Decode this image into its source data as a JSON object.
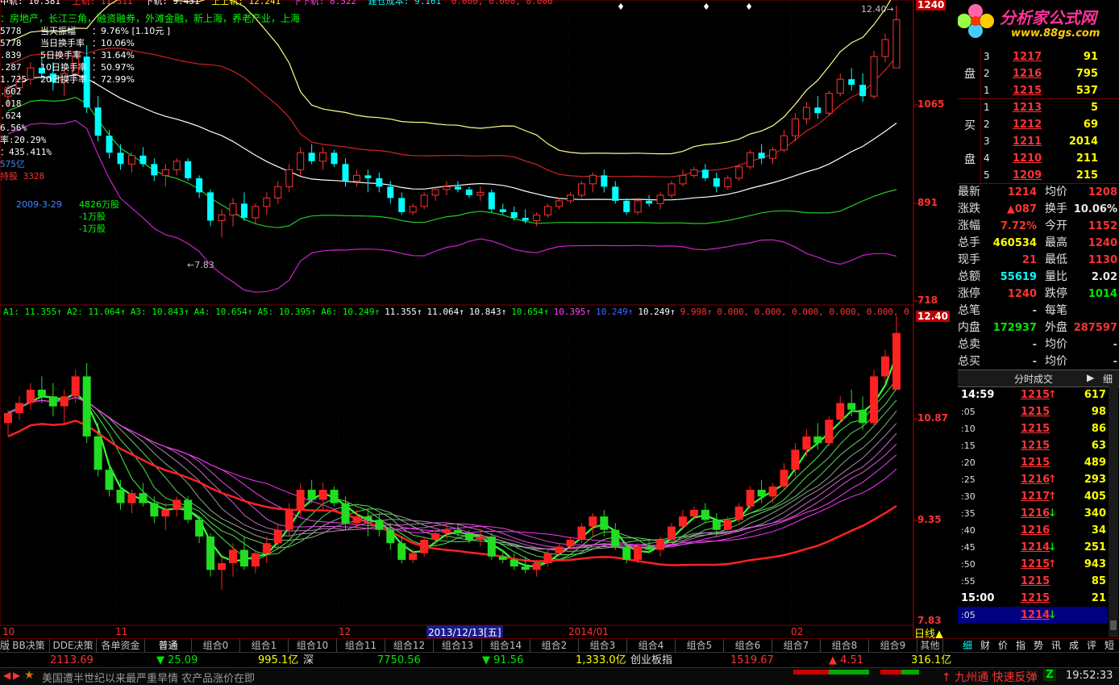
{
  "chart_top": {
    "stock_tags": "：房地产，长江三角，融资融券，外滩金融，新上海，养老产业，上海",
    "header_items": [
      "中轨: 10.381",
      "上轨: 11.311",
      "下轨: 9.451",
      "上上轨: 12.241",
      "下下轨: 8.522",
      "建仓成本: 9.161"
    ],
    "header_tail": "0.000, 0.000, 0.000",
    "left_cut": [
      "5778",
      "5778",
      ".839",
      ".287",
      "1.725",
      ".602",
      ".018",
      ".624",
      "6.56%",
      "率:20.29%",
      "：435.411%",
      "575亿",
      "持股 3328"
    ],
    "info_box": [
      {
        "label": "当天振幅",
        "value": "：9.76% [1.10元 ]"
      },
      {
        "label": "当日换手率",
        "value": "：10.06%"
      },
      {
        "label": "5日换手率",
        "value": "：31.64%"
      },
      {
        "label": "10日换手率",
        "value": "：50.97%"
      },
      {
        "label": "20日换手率",
        "value": "：72.99%"
      }
    ],
    "annotation_date": "2009-3-29",
    "annotation_lines": [
      "4826万股",
      "-1万股",
      "-1万股"
    ],
    "low_marker": "7.83",
    "high_marker": "12.40",
    "price_axis": [
      "1240",
      "1065",
      "891",
      "718"
    ]
  },
  "chart_bottom": {
    "indicator_line": [
      {
        "text": "A1: 11.355↑",
        "color": "#00ff00"
      },
      {
        "text": "A2: 11.064↑",
        "color": "#00ff00"
      },
      {
        "text": "A3: 10.843↑",
        "color": "#00ff00"
      },
      {
        "text": "A4: 10.654↑",
        "color": "#00ff00"
      },
      {
        "text": "A5: 10.395↑",
        "color": "#00ff00"
      },
      {
        "text": "A6: 10.249↑",
        "color": "#00ff00"
      },
      {
        "text": "11.355↑",
        "color": "#ffffff"
      },
      {
        "text": "11.064↑",
        "color": "#ffffff"
      },
      {
        "text": "10.843↑",
        "color": "#ffffff"
      },
      {
        "text": "10.654↑",
        "color": "#00ff00"
      },
      {
        "text": "10.395↑",
        "color": "#ff44ff"
      },
      {
        "text": "10.249↑",
        "color": "#4466ff"
      },
      {
        "text": "10.249↑",
        "color": "#ffffff"
      },
      {
        "text": "9.998↑",
        "color": "#ff3232"
      },
      {
        "text": "0.000, 0.000, 0.000, 0.000, 0.000, 0.000, 0.",
        "color": "#ff3232"
      }
    ],
    "price_axis": [
      "12.40",
      "10.87",
      "9.35",
      "7.83"
    ]
  },
  "date_axis": {
    "labels": [
      "10",
      "11",
      "12",
      "2013/12/13[五]",
      "2014/01",
      "02"
    ],
    "period": "日线▲"
  },
  "right_panel": {
    "logo_text": "分析家公式网",
    "logo_url": "www.88gs.com",
    "sell_label": "盘",
    "buy_label_1": "买",
    "buy_label_2": "盘",
    "sell_orders": [
      {
        "level": "3",
        "price": "1217",
        "vol": "91"
      },
      {
        "level": "2",
        "price": "1216",
        "vol": "795"
      },
      {
        "level": "1",
        "price": "1215",
        "vol": "537"
      }
    ],
    "buy_orders": [
      {
        "level": "1",
        "price": "1213",
        "vol": "5"
      },
      {
        "level": "2",
        "price": "1212",
        "vol": "69"
      },
      {
        "level": "3",
        "price": "1211",
        "vol": "2014"
      },
      {
        "level": "4",
        "price": "1210",
        "vol": "211"
      },
      {
        "level": "5",
        "price": "1209",
        "vol": "215"
      }
    ],
    "quote": [
      {
        "l1": "最新",
        "v1": "1214",
        "c1": "#ff3232",
        "l2": "均价",
        "v2": "1208",
        "c2": "#ff3232"
      },
      {
        "l1": "涨跌",
        "v1": "▲087",
        "c1": "#ff3232",
        "l2": "换手",
        "v2": "10.06%",
        "c2": "#e8e8e8"
      },
      {
        "l1": "涨幅",
        "v1": "7.72%",
        "c1": "#ff3232",
        "l2": "今开",
        "v2": "1152",
        "c2": "#ff3232"
      },
      {
        "l1": "总手",
        "v1": "460534",
        "c1": "#ffff00",
        "l2": "最高",
        "v2": "1240",
        "c2": "#ff3232"
      },
      {
        "l1": "现手",
        "v1": "21",
        "c1": "#ff3232",
        "l2": "最低",
        "v2": "1130",
        "c2": "#ff3232"
      },
      {
        "l1": "总额",
        "v1": "55619",
        "c1": "#00ffff",
        "l2": "量比",
        "v2": "2.02",
        "c2": "#e8e8e8"
      },
      {
        "l1": "涨停",
        "v1": "1240",
        "c1": "#ff3232",
        "l2": "跌停",
        "v2": "1014",
        "c2": "#00e600"
      },
      {
        "l1": "总笔",
        "v1": "-",
        "c1": "#c0c0c0",
        "l2": "每笔",
        "v2": "",
        "c2": "#c0c0c0"
      },
      {
        "l1": "内盘",
        "v1": "172937",
        "c1": "#00e600",
        "l2": "外盘",
        "v2": "287597",
        "c2": "#ff3232"
      },
      {
        "l1": "总卖",
        "v1": "-",
        "c1": "#c0c0c0",
        "l2": "均价",
        "v2": "-",
        "c2": "#c0c0c0"
      },
      {
        "l1": "总买",
        "v1": "-",
        "c1": "#c0c0c0",
        "l2": "均价",
        "v2": "-",
        "c2": "#c0c0c0"
      }
    ],
    "ticks_header": "分时成交",
    "ticks_tab": "细",
    "ticks": [
      {
        "time": "14:59",
        "price": "1215",
        "arrow": "↑",
        "vol": "617"
      },
      {
        "time": ":05",
        "price": "1215",
        "arrow": "",
        "vol": "98"
      },
      {
        "time": ":10",
        "price": "1215",
        "arrow": "",
        "vol": "86"
      },
      {
        "time": ":15",
        "price": "1215",
        "arrow": "",
        "vol": "63"
      },
      {
        "time": ":20",
        "price": "1215",
        "arrow": "",
        "vol": "489"
      },
      {
        "time": ":25",
        "price": "1216",
        "arrow": "↑",
        "vol": "293"
      },
      {
        "time": ":30",
        "price": "1217",
        "arrow": "↑",
        "vol": "405"
      },
      {
        "time": ":35",
        "price": "1216",
        "arrow": "↓",
        "vol": "340"
      },
      {
        "time": ":40",
        "price": "1216",
        "arrow": "",
        "vol": "34"
      },
      {
        "time": ":45",
        "price": "1214",
        "arrow": "↓",
        "vol": "251"
      },
      {
        "time": ":50",
        "price": "1215",
        "arrow": "↑",
        "vol": "943"
      },
      {
        "time": ":55",
        "price": "1215",
        "arrow": "",
        "vol": "85"
      },
      {
        "time": "15:00",
        "price": "1215",
        "arrow": "",
        "vol": "21"
      },
      {
        "time": ":05",
        "price": "1214",
        "arrow": "↓",
        "vol": ""
      }
    ]
  },
  "tabs": [
    "版",
    "BB决策",
    "DDE决策",
    "各单资金",
    "普通",
    "组合0",
    "组合1",
    "组合10",
    "组合11",
    "组合12",
    "组合13",
    "组合14",
    "组合2",
    "组合3",
    "组合4",
    "组合5",
    "组合6",
    "组合7",
    "组合8",
    "组合9",
    "其他"
  ],
  "side_tabs": [
    "细",
    "财",
    "价",
    "指",
    "势",
    "讯",
    "成",
    "评",
    "短"
  ],
  "status": {
    "sh_index": "2113.69",
    "sh_change": "▼ 25.09",
    "sh_amount": "995.1亿",
    "sz_label": "深",
    "sz_index": "7750.56",
    "sz_change": "▼ 91.56",
    "sz_amount": "1,333.0亿",
    "cy_label": "创业板指",
    "cy_index": "1519.67",
    "cy_change": "▲ 4.51",
    "cy_amount": "316.1亿"
  },
  "news": {
    "headline": "美国遭半世纪以来最严重旱情 农产品涨价在即",
    "ticker": "九州通  快速反弹",
    "time": "19:52:33"
  },
  "chart_data": {
    "type": "candlestick",
    "price_range": [
      7.18,
      12.4
    ],
    "bottom_range": [
      7.83,
      12.4
    ],
    "candles": [
      [
        10.8,
        11.0,
        10.6,
        10.95
      ],
      [
        10.95,
        11.2,
        10.85,
        11.1
      ],
      [
        11.1,
        11.4,
        11.0,
        11.3
      ],
      [
        11.3,
        11.5,
        11.1,
        11.2
      ],
      [
        11.2,
        11.4,
        10.9,
        11.05
      ],
      [
        11.05,
        11.3,
        10.8,
        11.2
      ],
      [
        11.2,
        11.6,
        11.1,
        11.5
      ],
      [
        11.5,
        11.7,
        10.5,
        10.6
      ],
      [
        10.6,
        10.8,
        10.0,
        10.1
      ],
      [
        10.1,
        10.2,
        9.7,
        9.8
      ],
      [
        9.8,
        9.95,
        9.5,
        9.6
      ],
      [
        9.6,
        9.8,
        9.45,
        9.75
      ],
      [
        9.75,
        9.9,
        9.55,
        9.6
      ],
      [
        9.6,
        9.7,
        9.3,
        9.4
      ],
      [
        9.4,
        9.6,
        9.2,
        9.5
      ],
      [
        9.5,
        9.7,
        9.4,
        9.65
      ],
      [
        9.65,
        9.7,
        9.3,
        9.35
      ],
      [
        9.35,
        9.4,
        9.0,
        9.1
      ],
      [
        9.1,
        9.15,
        8.5,
        8.6
      ],
      [
        8.6,
        8.8,
        8.3,
        8.7
      ],
      [
        8.7,
        9.0,
        8.5,
        8.9
      ],
      [
        8.9,
        9.1,
        8.6,
        8.65
      ],
      [
        8.65,
        8.9,
        8.55,
        8.85
      ],
      [
        8.85,
        9.1,
        8.7,
        9.0
      ],
      [
        9.0,
        9.3,
        8.9,
        9.2
      ],
      [
        9.2,
        9.6,
        9.1,
        9.5
      ],
      [
        9.5,
        9.9,
        9.4,
        9.8
      ],
      [
        9.8,
        9.95,
        9.6,
        9.65
      ],
      [
        9.65,
        9.9,
        9.5,
        9.8
      ],
      [
        9.8,
        9.85,
        9.55,
        9.6
      ],
      [
        9.6,
        9.7,
        9.2,
        9.3
      ],
      [
        9.3,
        9.5,
        9.2,
        9.4
      ],
      [
        9.4,
        9.5,
        9.1,
        9.35
      ],
      [
        9.35,
        9.45,
        9.1,
        9.2
      ],
      [
        9.2,
        9.3,
        8.9,
        9.0
      ],
      [
        9.0,
        9.1,
        8.7,
        8.75
      ],
      [
        8.75,
        8.9,
        8.7,
        8.85
      ],
      [
        8.85,
        9.1,
        8.8,
        9.05
      ],
      [
        9.05,
        9.2,
        8.95,
        9.15
      ],
      [
        9.15,
        9.3,
        9.05,
        9.2
      ],
      [
        9.2,
        9.3,
        9.1,
        9.15
      ],
      [
        9.15,
        9.2,
        9.0,
        9.05
      ],
      [
        9.05,
        9.2,
        8.95,
        9.1
      ],
      [
        9.1,
        9.15,
        8.75,
        8.8
      ],
      [
        8.8,
        8.9,
        8.7,
        8.75
      ],
      [
        8.75,
        8.85,
        8.6,
        8.65
      ],
      [
        8.65,
        8.8,
        8.55,
        8.6
      ],
      [
        8.6,
        8.75,
        8.5,
        8.7
      ],
      [
        8.7,
        8.9,
        8.65,
        8.85
      ],
      [
        8.85,
        9.0,
        8.8,
        8.95
      ],
      [
        8.95,
        9.1,
        8.9,
        9.05
      ],
      [
        9.05,
        9.3,
        9.0,
        9.25
      ],
      [
        9.25,
        9.45,
        9.1,
        9.4
      ],
      [
        9.4,
        9.5,
        9.1,
        9.2
      ],
      [
        9.2,
        9.3,
        8.9,
        8.95
      ],
      [
        8.95,
        9.0,
        8.7,
        8.75
      ],
      [
        8.75,
        9.0,
        8.7,
        8.95
      ],
      [
        8.95,
        9.05,
        8.85,
        8.9
      ],
      [
        8.9,
        9.1,
        8.8,
        9.05
      ],
      [
        9.05,
        9.3,
        9.0,
        9.25
      ],
      [
        9.25,
        9.5,
        9.2,
        9.4
      ],
      [
        9.4,
        9.55,
        9.35,
        9.5
      ],
      [
        9.5,
        9.6,
        9.3,
        9.35
      ],
      [
        9.35,
        9.45,
        9.1,
        9.2
      ],
      [
        9.2,
        9.4,
        9.15,
        9.35
      ],
      [
        9.35,
        9.6,
        9.3,
        9.55
      ],
      [
        9.55,
        9.85,
        9.5,
        9.8
      ],
      [
        9.8,
        9.95,
        9.6,
        9.7
      ],
      [
        9.7,
        9.9,
        9.6,
        9.85
      ],
      [
        9.85,
        10.2,
        9.8,
        10.1
      ],
      [
        10.1,
        10.5,
        10.0,
        10.4
      ],
      [
        10.4,
        10.7,
        10.3,
        10.6
      ],
      [
        10.6,
        10.8,
        10.4,
        10.5
      ],
      [
        10.5,
        10.9,
        10.45,
        10.85
      ],
      [
        10.85,
        11.2,
        10.8,
        11.1
      ],
      [
        11.1,
        11.3,
        10.9,
        11.0
      ],
      [
        11.0,
        11.2,
        10.7,
        10.8
      ],
      [
        10.8,
        11.6,
        10.75,
        11.5
      ],
      [
        11.5,
        11.9,
        11.4,
        11.8
      ],
      [
        11.3,
        12.4,
        11.3,
        12.15
      ]
    ]
  }
}
